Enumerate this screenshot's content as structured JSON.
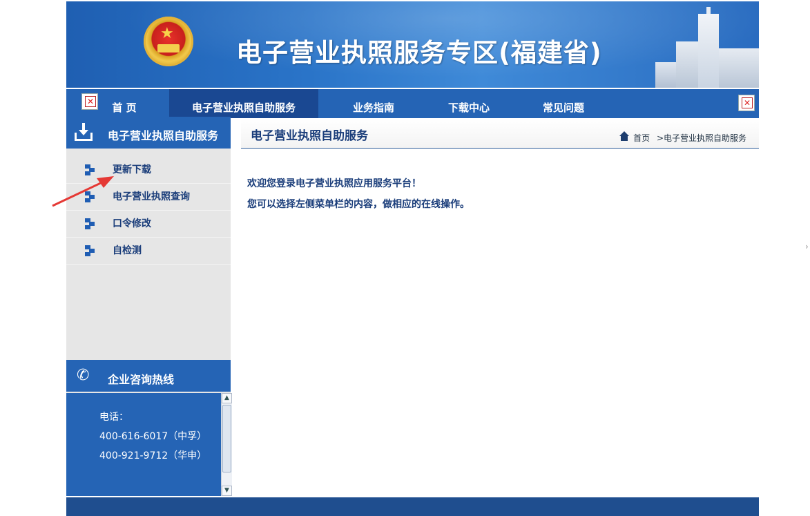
{
  "header": {
    "site_title": "电子营业执照服务专区(福建省)"
  },
  "nav": {
    "tabs": [
      {
        "label": "首  页"
      },
      {
        "label": "电子营业执照自助服务",
        "active": true
      },
      {
        "label": "业务指南"
      },
      {
        "label": "下载中心"
      },
      {
        "label": "常见问题"
      }
    ]
  },
  "sidebar": {
    "title": "电子营业执照自助服务",
    "items": [
      {
        "label": "更新下载"
      },
      {
        "label": "电子营业执照查询"
      },
      {
        "label": "口令修改"
      },
      {
        "label": "自检测"
      }
    ],
    "hotline": {
      "title": "企业咨询热线",
      "lines": [
        "电话：",
        "400-616-6017（中孚）",
        "400-921-9712（华申）"
      ]
    }
  },
  "main": {
    "title": "电子营业执照自助服务",
    "breadcrumb": {
      "home": "首页",
      "current": ">电子营业执照自助服务"
    },
    "welcome_lines": [
      "欢迎您登录电子营业执照应用服务平台！",
      "您可以选择左侧菜单栏的内容，做相应的在线操作。"
    ]
  },
  "colors": {
    "primary": "#2564b5",
    "active_tab": "#1a4892",
    "text_dark_blue": "#1a3d7a",
    "annotation_arrow": "#e53935"
  },
  "icons": [
    "national-emblem",
    "broken-image-icon",
    "download-icon",
    "phone-icon",
    "home-icon",
    "bullet-icon",
    "annotation-arrow"
  ]
}
